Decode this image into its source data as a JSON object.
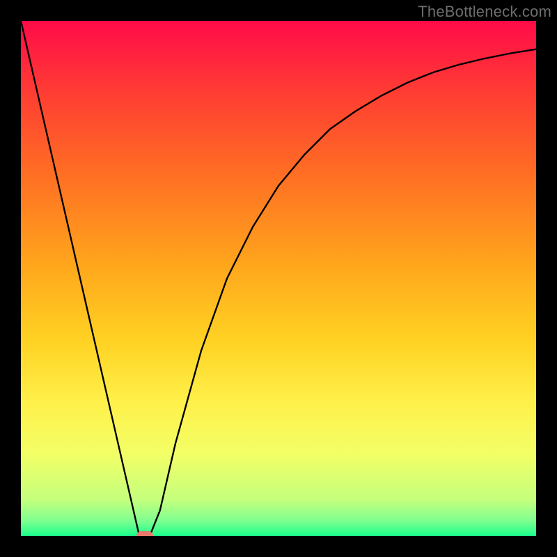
{
  "watermark": "TheBottleneck.com",
  "chart_data": {
    "type": "line",
    "title": "",
    "xlabel": "",
    "ylabel": "",
    "xlim": [
      0,
      100
    ],
    "ylim": [
      0,
      100
    ],
    "grid": false,
    "series": [
      {
        "name": "curve",
        "x": [
          0,
          23,
          25,
          27,
          30,
          35,
          40,
          45,
          50,
          55,
          60,
          65,
          70,
          75,
          80,
          85,
          90,
          95,
          100
        ],
        "y": [
          100,
          0,
          0,
          5,
          18,
          36,
          50,
          60,
          68,
          74,
          79,
          82.5,
          85.5,
          88,
          90,
          91.5,
          92.7,
          93.7,
          94.5
        ]
      }
    ],
    "gradient_stops": [
      {
        "offset": 0.0,
        "color": "#ff0b48"
      },
      {
        "offset": 0.14,
        "color": "#ff3d33"
      },
      {
        "offset": 0.3,
        "color": "#ff6f23"
      },
      {
        "offset": 0.48,
        "color": "#ffa81c"
      },
      {
        "offset": 0.62,
        "color": "#ffd223"
      },
      {
        "offset": 0.74,
        "color": "#fff04a"
      },
      {
        "offset": 0.84,
        "color": "#f3ff66"
      },
      {
        "offset": 0.93,
        "color": "#c4ff7d"
      },
      {
        "offset": 0.97,
        "color": "#7fff90"
      },
      {
        "offset": 1.0,
        "color": "#1aff8b"
      }
    ],
    "marker": {
      "x": 24,
      "y": 0,
      "color": "#e9776c"
    }
  }
}
